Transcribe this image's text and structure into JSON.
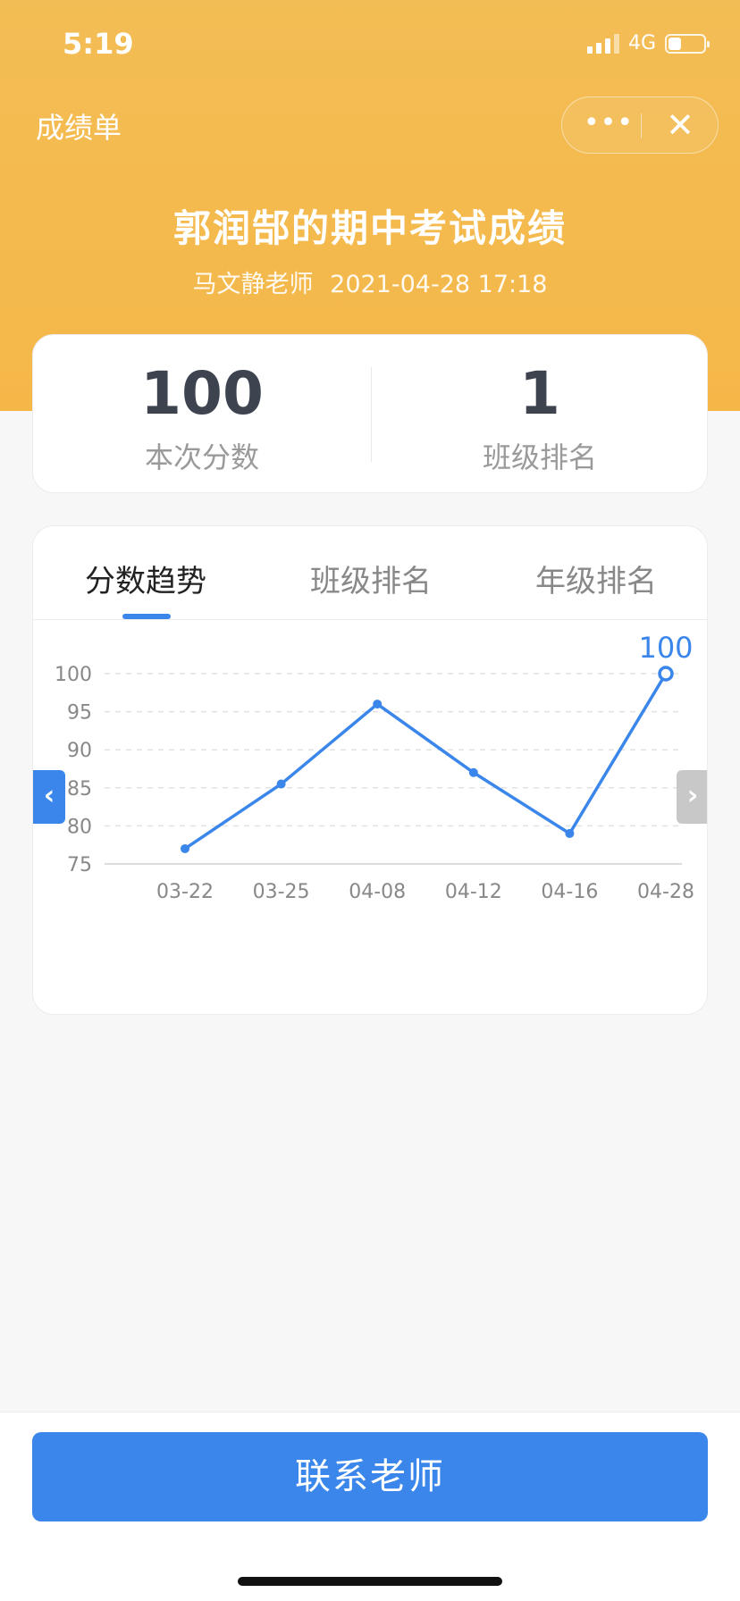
{
  "status_bar": {
    "time": "5:19",
    "network": "4G",
    "icons": [
      "signal-icon",
      "battery-icon"
    ]
  },
  "nav": {
    "title": "成绩单",
    "more_icon": "more-dots-icon",
    "close_icon": "close-icon"
  },
  "header": {
    "title": "郭润郜的期中考试成绩",
    "teacher": "马文静老师",
    "datetime": "2021-04-28 17:18"
  },
  "summary": {
    "score_value": "100",
    "score_label": "本次分数",
    "rank_value": "1",
    "rank_label": "班级排名"
  },
  "tabs": [
    {
      "label": "分数趋势",
      "active": true
    },
    {
      "label": "班级排名",
      "active": false
    },
    {
      "label": "年级排名",
      "active": false
    }
  ],
  "chart_data": {
    "type": "line",
    "categories": [
      "03-22",
      "03-25",
      "04-08",
      "04-12",
      "04-16",
      "04-28"
    ],
    "values": [
      77,
      85.5,
      96,
      87,
      79,
      100
    ],
    "ylim": [
      75,
      100
    ],
    "yticks": [
      75,
      80,
      85,
      90,
      95,
      100
    ],
    "grid": true,
    "highlight_label": "100",
    "line_color": "#3a86ea"
  },
  "footer": {
    "contact_label": "联系老师"
  },
  "colors": {
    "header": "#f4bb50",
    "accent": "#3a86ea"
  }
}
